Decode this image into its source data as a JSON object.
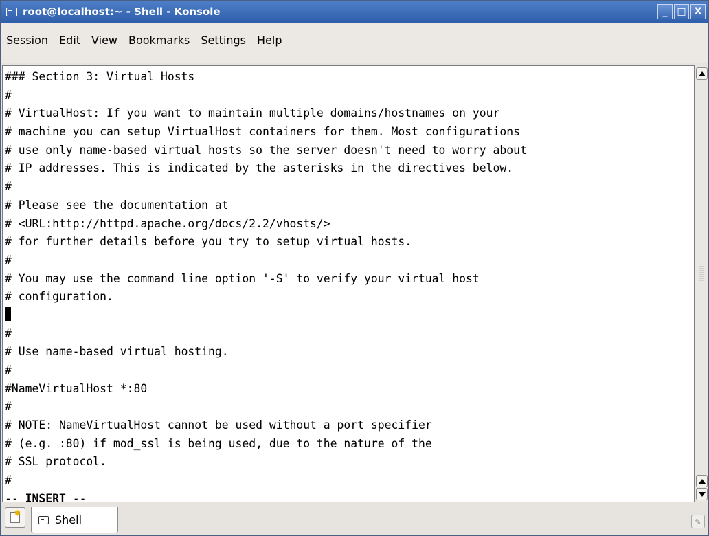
{
  "window": {
    "title": "root@localhost:~ - Shell - Konsole",
    "buttons": {
      "minimize": "_",
      "maximize": "□",
      "close": "X"
    }
  },
  "menu": {
    "items": [
      "Session",
      "Edit",
      "View",
      "Bookmarks",
      "Settings",
      "Help"
    ]
  },
  "terminal": {
    "lines": [
      "### Section 3: Virtual Hosts",
      "#",
      "# VirtualHost: If you want to maintain multiple domains/hostnames on your",
      "# machine you can setup VirtualHost containers for them. Most configurations",
      "# use only name-based virtual hosts so the server doesn't need to worry about",
      "# IP addresses. This is indicated by the asterisks in the directives below.",
      "#",
      "# Please see the documentation at",
      "# <URL:http://httpd.apache.org/docs/2.2/vhosts/>",
      "# for further details before you try to setup virtual hosts.",
      "#",
      "# You may use the command line option '-S' to verify your virtual host",
      "# configuration.",
      "",
      "#",
      "# Use name-based virtual hosting.",
      "#",
      "#NameVirtualHost *:80",
      "#",
      "# NOTE: NameVirtualHost cannot be used without a port specifier",
      "# (e.g. :80) if mod_ssl is being used, due to the nature of the",
      "# SSL protocol.",
      "#"
    ],
    "mode_prefix": "-- ",
    "mode_label": "INSERT",
    "mode_suffix": " --"
  },
  "tabs": {
    "items": [
      {
        "label": "Shell"
      }
    ]
  },
  "colors": {
    "titlebar": "#3b6cb8",
    "terminal_bg": "#ffffff",
    "terminal_fg": "#000000"
  }
}
